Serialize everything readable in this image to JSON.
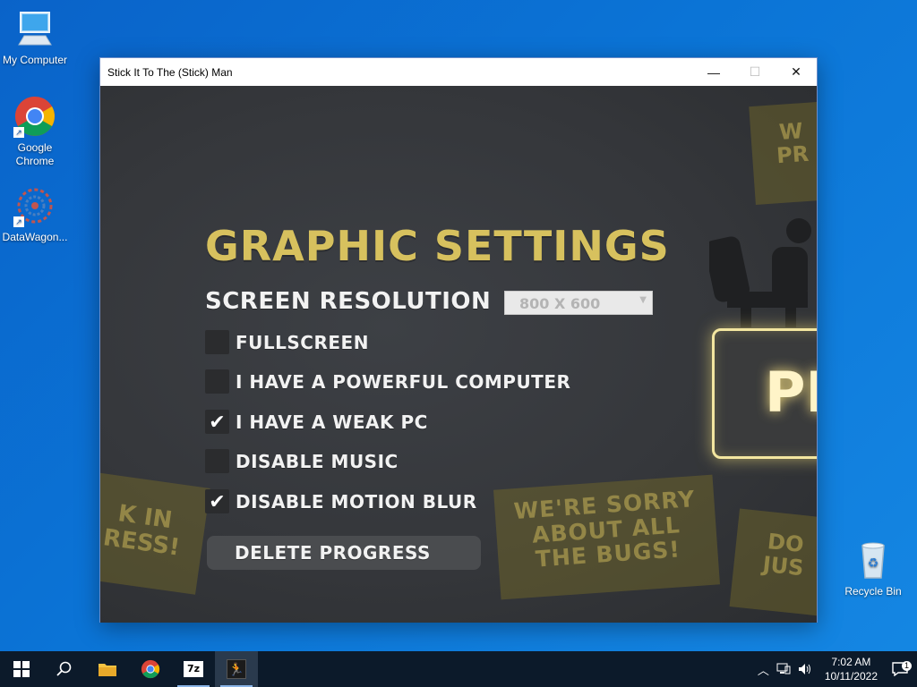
{
  "desktop": {
    "icons": [
      {
        "label": "My Computer"
      },
      {
        "label": "Google Chrome"
      },
      {
        "label": "DataWagon..."
      },
      {
        "label": "Recycle Bin"
      }
    ]
  },
  "window": {
    "title": "Stick It To The (Stick) Man",
    "minimize": "—",
    "maximize": "☐",
    "close": "✕"
  },
  "game": {
    "settings_title": "GRAPHIC SETTINGS",
    "resolution_label": "SCREEN RESOLUTION",
    "resolution_value": "800 X 600",
    "options": [
      {
        "label": "FULLSCREEN",
        "checked": false
      },
      {
        "label": "I HAVE A POWERFUL COMPUTER",
        "checked": false
      },
      {
        "label": "I HAVE A WEAK PC",
        "checked": true
      },
      {
        "label": "DISABLE MUSIC",
        "checked": false
      },
      {
        "label": "DISABLE MOTION BLUR",
        "checked": true
      }
    ],
    "delete_label": "DELETE PROGRESS",
    "play_label": "PL",
    "posters": {
      "top_right": "W\nPR",
      "left": "K IN\nRESS!",
      "sorry": "WE'RE SORRY\nABOUT ALL\nTHE BUGS!",
      "right": "DO\nJUS"
    },
    "accent_color": "#d7c15e"
  },
  "taskbar": {
    "time": "7:02 AM",
    "date": "10/11/2022",
    "notification_count": "1"
  }
}
